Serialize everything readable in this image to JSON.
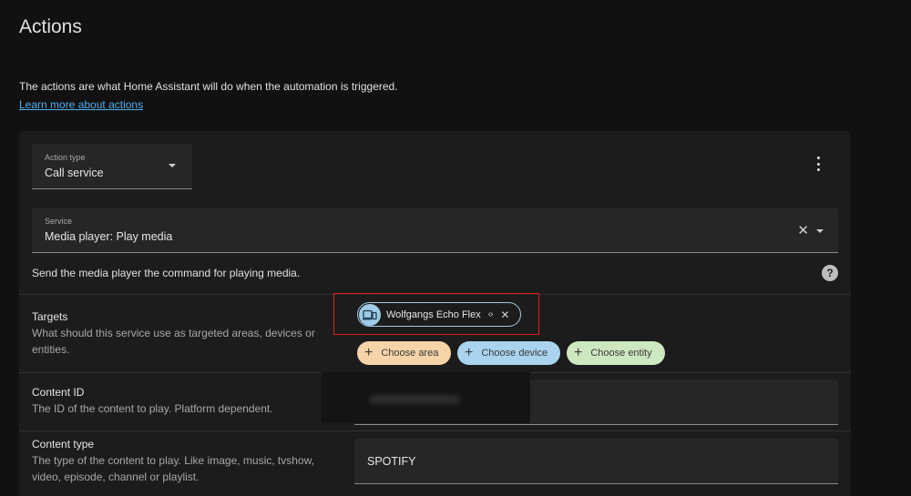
{
  "page": {
    "title": "Actions",
    "intro": "The actions are what Home Assistant will do when the automation is triggered.",
    "learn_more": "Learn more about actions"
  },
  "action_card": {
    "action_type": {
      "label": "Action type",
      "value": "Call service"
    },
    "service": {
      "label": "Service",
      "value": "Media player: Play media"
    },
    "description": "Send the media player the command for playing media.",
    "help_icon": "?",
    "targets": {
      "title": "Targets",
      "description": "What should this service use as targeted areas, devices or entities.",
      "selected_device": {
        "label": "Wolfgangs Echo Flex",
        "expand_icon": "‹›",
        "remove_icon": "✕"
      },
      "choose_area": "Choose area",
      "choose_device": "Choose device",
      "choose_entity": "Choose entity",
      "plus_icon": "+"
    },
    "content_id": {
      "title": "Content ID",
      "description": "The ID of the content to play. Platform dependent."
    },
    "content_type": {
      "title": "Content type",
      "description": "The type of the content to play. Like image, music, tvshow, video, episode, channel or playlist.",
      "value": "SPOTIFY"
    },
    "service_clear_icon": "✕"
  },
  "colors": {
    "background": "#111111",
    "card": "#1c1c1c",
    "link": "#4fb0f0",
    "highlight": "#e01b1b",
    "area_chip": "#f6d3a8",
    "device_chip": "#a9d3ef",
    "entity_chip": "#cde8c0"
  }
}
